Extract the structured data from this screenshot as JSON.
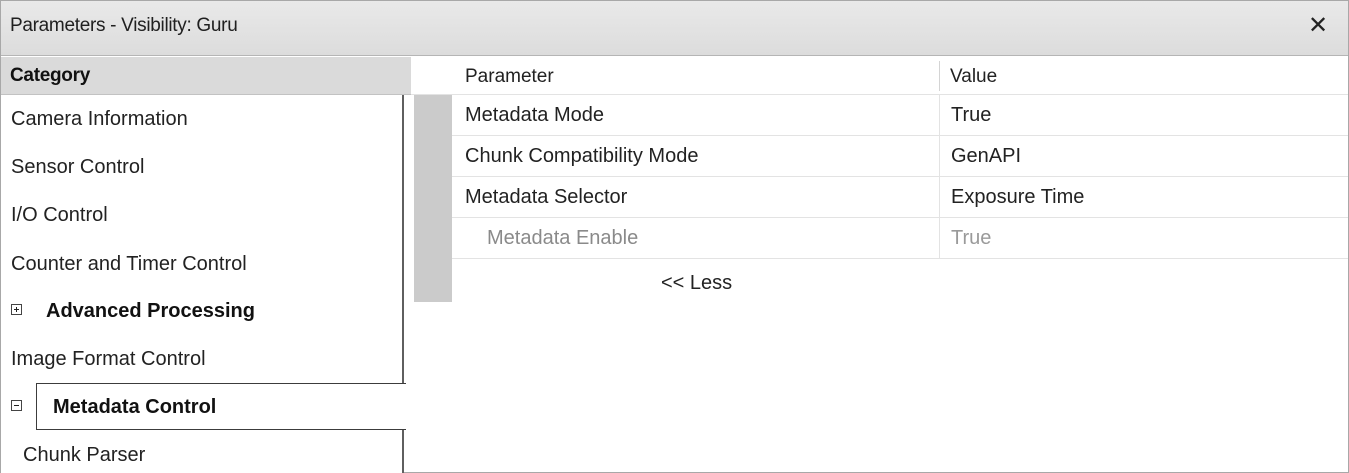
{
  "window": {
    "title": "Parameters - Visibility: Guru",
    "close_glyph": "✕"
  },
  "category_pane": {
    "header": "Category",
    "items": [
      {
        "label": "Camera Information"
      },
      {
        "label": "Sensor Control"
      },
      {
        "label": "I/O Control"
      },
      {
        "label": "Counter and Timer Control"
      },
      {
        "label": "Advanced Processing",
        "expander": "plus",
        "bold": true
      },
      {
        "label": "Image Format Control"
      },
      {
        "label": "Metadata Control",
        "expander": "minus",
        "bold": true,
        "selected": true
      },
      {
        "label": "Chunk Parser",
        "sub": true
      }
    ]
  },
  "parameter_pane": {
    "columns": {
      "parameter": "Parameter",
      "value": "Value"
    },
    "rows": [
      {
        "name": "Metadata Mode",
        "value": "True"
      },
      {
        "name": "Chunk Compatibility Mode",
        "value": "GenAPI"
      },
      {
        "name": "Metadata Selector",
        "value": "Exposure Time"
      },
      {
        "name": "Metadata Enable",
        "value": "True",
        "disabled": true
      }
    ],
    "less_link": "<< Less"
  },
  "icons": {
    "close": "close-icon",
    "expand": "plus-box-icon",
    "collapse": "minus-box-icon"
  }
}
